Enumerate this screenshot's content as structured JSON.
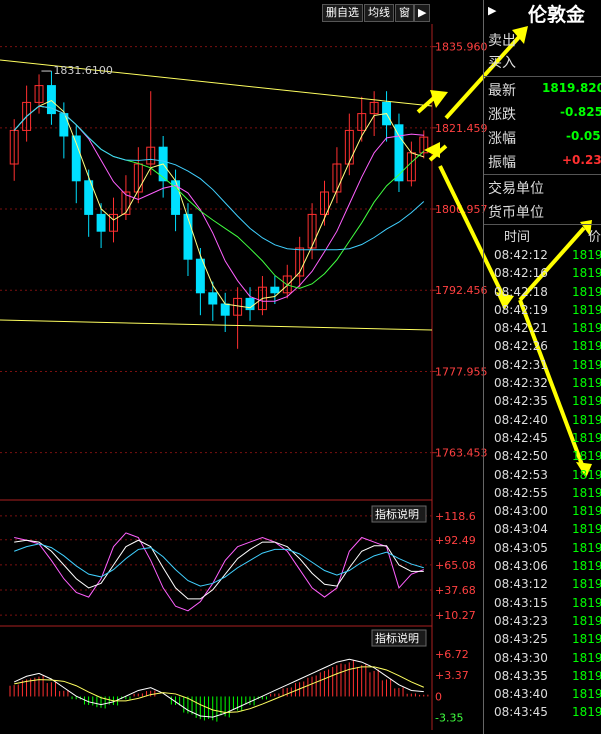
{
  "toolbar": {
    "delete_select": "删自选",
    "ma_line": "均线",
    "window": "窗",
    "play_icon": "play-icon"
  },
  "side": {
    "title": "伦敦金",
    "sell": "卖出",
    "buy": "买入",
    "latest_label": "最新",
    "latest_value": "1819.820",
    "change_label": "涨跌",
    "change_value": "-0.825",
    "pct_label": "涨幅",
    "pct_value": "-0.05",
    "amp_label": "振幅",
    "amp_value": "+0.23",
    "trade_unit": "交易单位",
    "currency_unit": "货币单位",
    "col_time": "时间",
    "col_price": "价",
    "ticks": [
      {
        "t": "08:42:12",
        "p": "1819"
      },
      {
        "t": "08:42:16",
        "p": "1819"
      },
      {
        "t": "08:42:18",
        "p": "1819"
      },
      {
        "t": "08:42:19",
        "p": "1819"
      },
      {
        "t": "08:42:21",
        "p": "1819"
      },
      {
        "t": "08:42:26",
        "p": "1819"
      },
      {
        "t": "08:42:31",
        "p": "1819"
      },
      {
        "t": "08:42:32",
        "p": "1819"
      },
      {
        "t": "08:42:35",
        "p": "1819"
      },
      {
        "t": "08:42:40",
        "p": "1819"
      },
      {
        "t": "08:42:45",
        "p": "1819"
      },
      {
        "t": "08:42:50",
        "p": "1819"
      },
      {
        "t": "08:42:53",
        "p": "1819"
      },
      {
        "t": "08:42:55",
        "p": "1819"
      },
      {
        "t": "08:43:00",
        "p": "1819"
      },
      {
        "t": "08:43:04",
        "p": "1819"
      },
      {
        "t": "08:43:05",
        "p": "1819"
      },
      {
        "t": "08:43:06",
        "p": "1819"
      },
      {
        "t": "08:43:12",
        "p": "1819"
      },
      {
        "t": "08:43:15",
        "p": "1819"
      },
      {
        "t": "08:43:23",
        "p": "1819"
      },
      {
        "t": "08:43:25",
        "p": "1819"
      },
      {
        "t": "08:43:30",
        "p": "1819"
      },
      {
        "t": "08:43:35",
        "p": "1819"
      },
      {
        "t": "08:43:40",
        "p": "1819"
      },
      {
        "t": "08:43:45",
        "p": "1819"
      }
    ]
  },
  "colors": {
    "up": "#ff3030",
    "down": "#00e0ff",
    "bg": "#000000",
    "grid": "#7a1010",
    "green": "#00ff00"
  },
  "chart_data": [
    {
      "type": "candlestick",
      "price_ticks": [
        "1835.960",
        "1821.459",
        "1806.957",
        "1792.456",
        "1777.955",
        "1763.453"
      ],
      "peak_label": "1831.6100",
      "ylim": [
        1755,
        1840
      ],
      "candles": [
        {
          "o": 1815,
          "c": 1821,
          "h": 1823,
          "l": 1812
        },
        {
          "o": 1821,
          "c": 1826,
          "h": 1829,
          "l": 1819
        },
        {
          "o": 1826,
          "c": 1829,
          "h": 1831,
          "l": 1824
        },
        {
          "o": 1829,
          "c": 1824,
          "h": 1831.6,
          "l": 1822
        },
        {
          "o": 1824,
          "c": 1820,
          "h": 1826,
          "l": 1816
        },
        {
          "o": 1820,
          "c": 1812,
          "h": 1822,
          "l": 1808
        },
        {
          "o": 1812,
          "c": 1806,
          "h": 1814,
          "l": 1802
        },
        {
          "o": 1806,
          "c": 1803,
          "h": 1808,
          "l": 1800
        },
        {
          "o": 1803,
          "c": 1806,
          "h": 1809,
          "l": 1801
        },
        {
          "o": 1806,
          "c": 1810,
          "h": 1813,
          "l": 1805
        },
        {
          "o": 1810,
          "c": 1815,
          "h": 1818,
          "l": 1808
        },
        {
          "o": 1815,
          "c": 1818,
          "h": 1828,
          "l": 1813
        },
        {
          "o": 1818,
          "c": 1812,
          "h": 1820,
          "l": 1809
        },
        {
          "o": 1812,
          "c": 1806,
          "h": 1814,
          "l": 1803
        },
        {
          "o": 1806,
          "c": 1798,
          "h": 1808,
          "l": 1795
        },
        {
          "o": 1798,
          "c": 1792,
          "h": 1800,
          "l": 1788
        },
        {
          "o": 1792,
          "c": 1790,
          "h": 1794,
          "l": 1787
        },
        {
          "o": 1790,
          "c": 1788,
          "h": 1792,
          "l": 1785
        },
        {
          "o": 1788,
          "c": 1791,
          "h": 1793,
          "l": 1782
        },
        {
          "o": 1791,
          "c": 1789,
          "h": 1793,
          "l": 1787
        },
        {
          "o": 1789,
          "c": 1793,
          "h": 1795,
          "l": 1788
        },
        {
          "o": 1793,
          "c": 1792,
          "h": 1795,
          "l": 1790
        },
        {
          "o": 1792,
          "c": 1795,
          "h": 1797,
          "l": 1791
        },
        {
          "o": 1795,
          "c": 1800,
          "h": 1802,
          "l": 1793
        },
        {
          "o": 1800,
          "c": 1806,
          "h": 1808,
          "l": 1798
        },
        {
          "o": 1806,
          "c": 1810,
          "h": 1812,
          "l": 1804
        },
        {
          "o": 1810,
          "c": 1815,
          "h": 1818,
          "l": 1808
        },
        {
          "o": 1815,
          "c": 1821,
          "h": 1824,
          "l": 1813
        },
        {
          "o": 1821,
          "c": 1824,
          "h": 1827,
          "l": 1819
        },
        {
          "o": 1824,
          "c": 1826,
          "h": 1828,
          "l": 1820
        },
        {
          "o": 1826,
          "c": 1822,
          "h": 1828,
          "l": 1819
        },
        {
          "o": 1822,
          "c": 1812,
          "h": 1824,
          "l": 1810
        },
        {
          "o": 1812,
          "c": 1817,
          "h": 1819,
          "l": 1811
        },
        {
          "o": 1817,
          "c": 1819.8,
          "h": 1821,
          "l": 1816
        }
      ]
    },
    {
      "type": "line",
      "name": "indicator-1",
      "ticks": [
        "+118.6",
        "+92.49",
        "+65.08",
        "+37.68",
        "+10.27"
      ],
      "ylim": [
        5,
        125
      ],
      "series": [
        {
          "values": [
            95,
            92,
            88,
            70,
            50,
            35,
            30,
            50,
            85,
            100,
            95,
            70,
            40,
            20,
            15,
            25,
            45,
            70,
            85,
            90,
            95,
            90,
            80,
            60,
            40,
            30,
            40,
            80,
            95,
            90,
            85,
            40,
            55,
            60
          ]
        },
        {
          "values": [
            90,
            92,
            90,
            80,
            65,
            50,
            40,
            45,
            65,
            85,
            92,
            85,
            62,
            40,
            28,
            28,
            38,
            55,
            72,
            82,
            90,
            90,
            85,
            72,
            56,
            44,
            42,
            62,
            80,
            86,
            86,
            65,
            58,
            58
          ]
        },
        {
          "values": [
            80,
            85,
            88,
            84,
            75,
            64,
            55,
            52,
            60,
            72,
            82,
            84,
            74,
            60,
            48,
            42,
            45,
            52,
            62,
            70,
            78,
            82,
            82,
            77,
            68,
            59,
            54,
            59,
            68,
            75,
            79,
            72,
            66,
            62
          ]
        }
      ],
      "button": "指标说明"
    },
    {
      "type": "bar",
      "name": "indicator-2",
      "ticks": [
        "+6.72",
        "+3.37",
        "0",
        "-3.35"
      ],
      "ylim": [
        -5,
        8
      ],
      "values": [
        2,
        3,
        3.5,
        2.5,
        1,
        -0.5,
        -1.5,
        -2,
        -1.5,
        -0.5,
        0.5,
        1,
        0,
        -1.5,
        -3,
        -4,
        -4.2,
        -3.5,
        -2.5,
        -1.5,
        -0.5,
        0.5,
        1.5,
        2.5,
        3.5,
        4.5,
        5.5,
        6,
        5.5,
        4.5,
        3,
        1.5,
        0.5,
        0.3
      ],
      "button": "指标说明"
    }
  ]
}
